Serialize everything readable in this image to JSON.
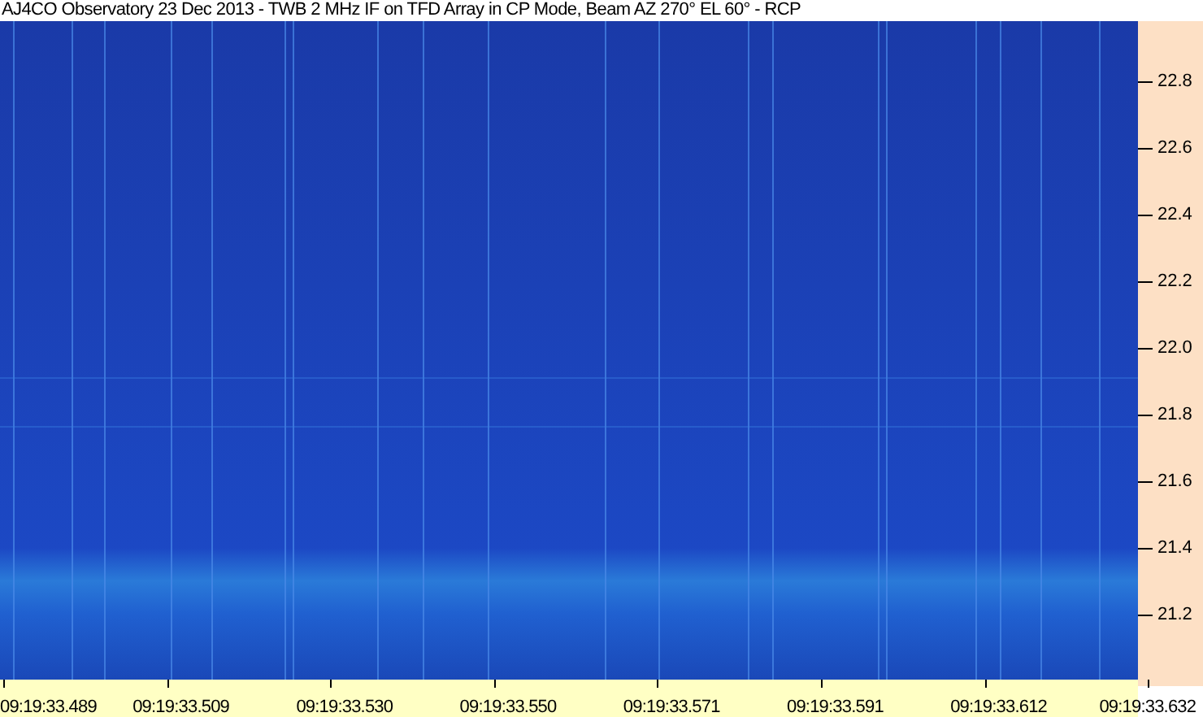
{
  "window": {
    "title": "AJ4CO Observatory 23 Dec 2013 - TWB 2 MHz IF on TFD Array in CP Mode, Beam AZ 270° EL 60° - RCP"
  },
  "frequency_axis": {
    "labels": [
      "22.8",
      "22.6",
      "22.4",
      "22.2",
      "22.0",
      "21.8",
      "21.6",
      "21.4",
      "21.2"
    ]
  },
  "time_axis": {
    "labels": [
      "09:19:33.489",
      "09:19:33.509",
      "09:19:33.530",
      "09:19:33.550",
      "09:19:33.571",
      "09:19:33.591",
      "09:19:33.612",
      "09:19:33.632"
    ]
  }
}
